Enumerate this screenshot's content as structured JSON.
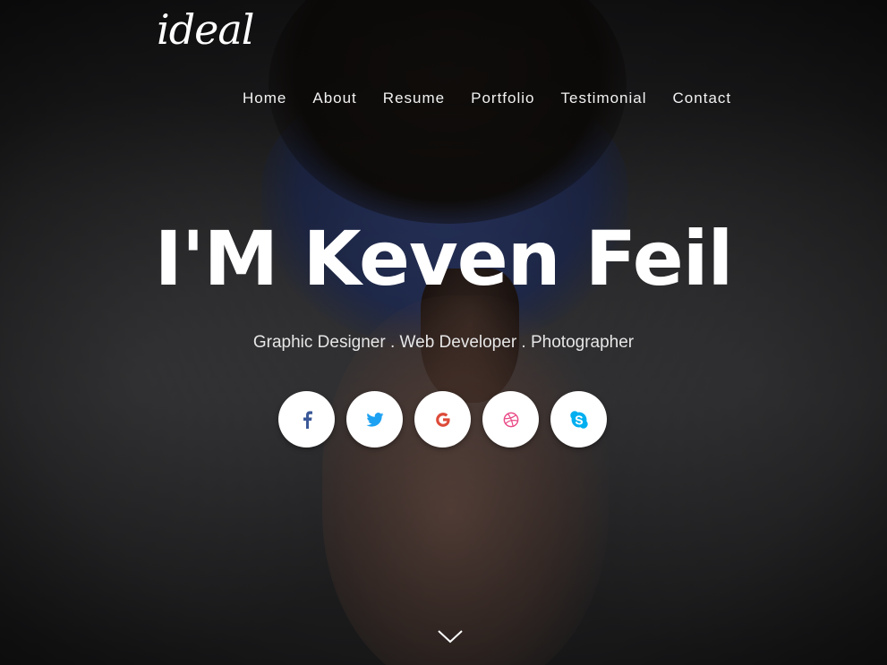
{
  "brand": {
    "logo_text": "ideal"
  },
  "nav": {
    "items": [
      {
        "label": "Home"
      },
      {
        "label": "About"
      },
      {
        "label": "Resume"
      },
      {
        "label": "Portfolio"
      },
      {
        "label": "Testimonial"
      },
      {
        "label": "Contact"
      }
    ]
  },
  "hero": {
    "title": "I'M Keven Feil",
    "subtitle": "Graphic Designer . Web Developer . Photographer"
  },
  "social": {
    "buttons": [
      {
        "icon": "facebook-icon",
        "color": "#3b5998"
      },
      {
        "icon": "twitter-icon",
        "color": "#1da1f2"
      },
      {
        "icon": "google-icon",
        "color": "#dd4b39"
      },
      {
        "icon": "dribbble-icon",
        "color": "#ea4c89"
      },
      {
        "icon": "skype-icon",
        "color": "#00aff0"
      }
    ]
  },
  "scroll": {
    "icon": "chevron-down-icon"
  }
}
